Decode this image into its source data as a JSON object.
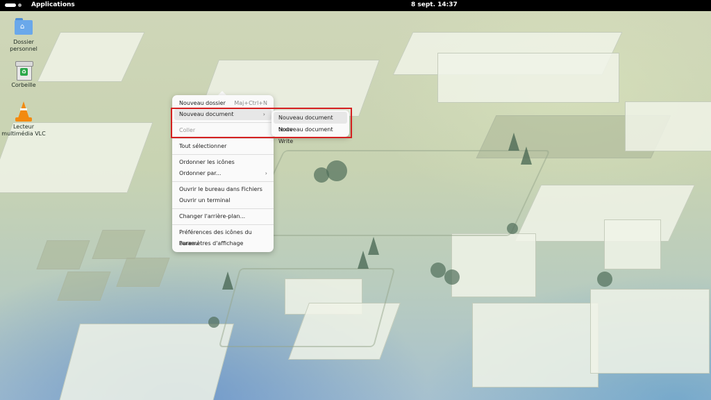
{
  "topbar": {
    "applications_label": "Applications",
    "clock": "8 sept.  14:37"
  },
  "desktop_icons": [
    {
      "label": "Dossier personnel",
      "icon": "folder-home-icon"
    },
    {
      "label": "Corbeille",
      "icon": "trash-icon"
    },
    {
      "label": "Lecteur multimédia VLC",
      "icon": "vlc-icon"
    }
  ],
  "context_menu": {
    "items": [
      {
        "label": "Nouveau dossier",
        "accel": "Maj+Ctrl+N"
      },
      {
        "label": "Nouveau document",
        "submenu": true,
        "highlighted": true
      },
      {
        "label": "Coller",
        "disabled": true
      },
      {
        "label": "Tout sélectionner"
      },
      {
        "label": "Ordonner les icônes"
      },
      {
        "label": "Ordonner par...",
        "submenu": true
      },
      {
        "label": "Ouvrir le bureau dans Fichiers"
      },
      {
        "label": "Ouvrir un terminal"
      },
      {
        "label": "Changer l'arrière-plan..."
      },
      {
        "label": "Préférences des icônes du bureau"
      },
      {
        "label": "Paramètres d'affichage"
      }
    ],
    "submenu_arrow": "›"
  },
  "submenu": {
    "items": [
      {
        "label": "Nouveau document texte",
        "highlighted": true
      },
      {
        "label": "Nouveau document Write"
      }
    ]
  },
  "colors": {
    "highlight_box": "#d42020",
    "topbar": "#000000"
  }
}
